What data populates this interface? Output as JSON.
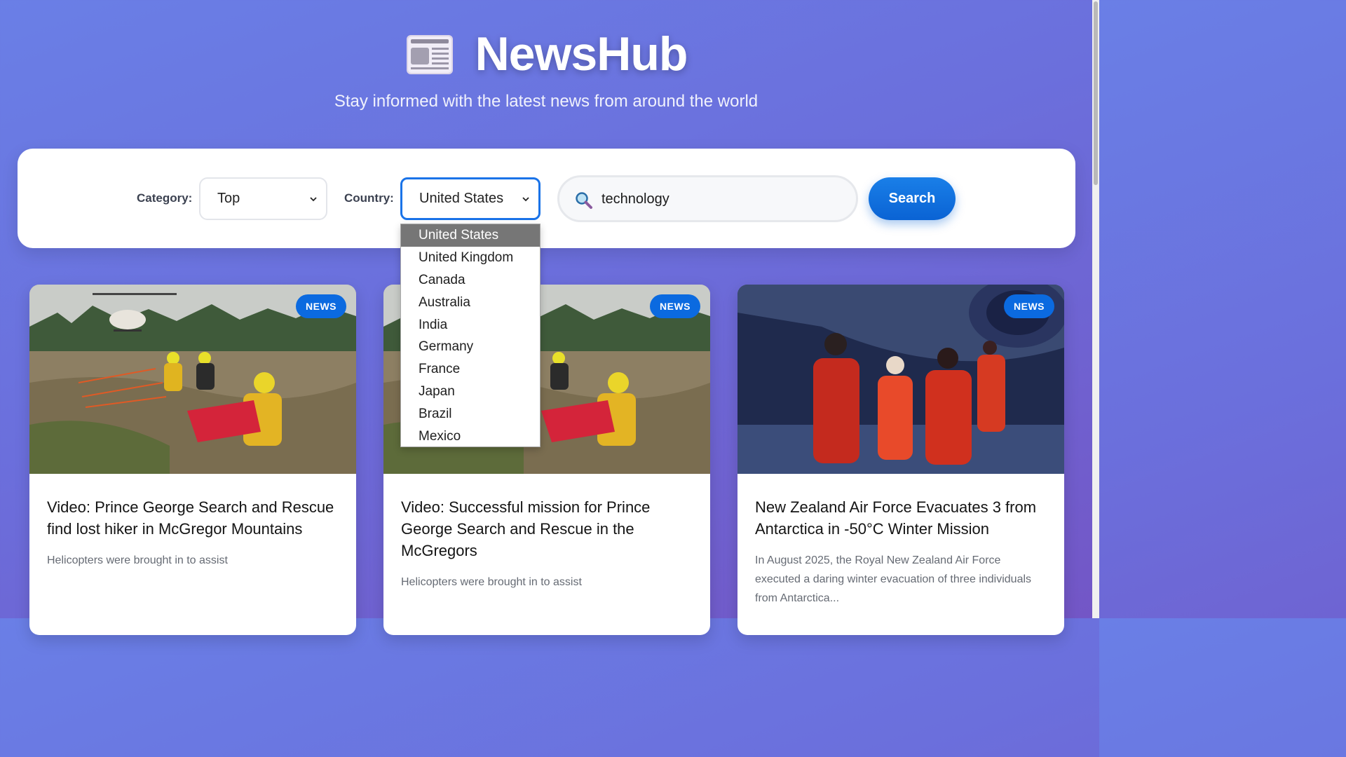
{
  "header": {
    "title": "NewsHub",
    "subtitle": "Stay informed with the latest news from around the world"
  },
  "filters": {
    "category_label": "Category:",
    "category_value": "Top",
    "country_label": "Country:",
    "country_value": "United States",
    "search_value": "technology",
    "search_button": "Search"
  },
  "country_dropdown": {
    "options": [
      "United States",
      "United Kingdom",
      "Canada",
      "Australia",
      "India",
      "Germany",
      "France",
      "Japan",
      "Brazil",
      "Mexico"
    ],
    "selected_index": 0
  },
  "articles": [
    {
      "badge": "NEWS",
      "title": "Video: Prince George Search and Rescue find lost hiker in McGregor Mountains",
      "description": "Helicopters were brought in to assist",
      "image": "rescue-helicopter-photo"
    },
    {
      "badge": "NEWS",
      "title": "Video: Successful mission for Prince George Search and Rescue in the McGregors",
      "description": "Helicopters were brought in to assist",
      "image": "rescue-helicopter-photo"
    },
    {
      "badge": "NEWS",
      "title": "New Zealand Air Force Evacuates 3 from Antarctica in -50°C Winter Mission",
      "description": "In August 2025, the Royal New Zealand Air Force executed a daring winter evacuation of three individuals from Antarctica...",
      "image": "antarctica-crew-photo"
    }
  ],
  "colors": {
    "accent": "#0b6ae0",
    "background_start": "#6a7fe6",
    "background_end": "#7356c6"
  }
}
